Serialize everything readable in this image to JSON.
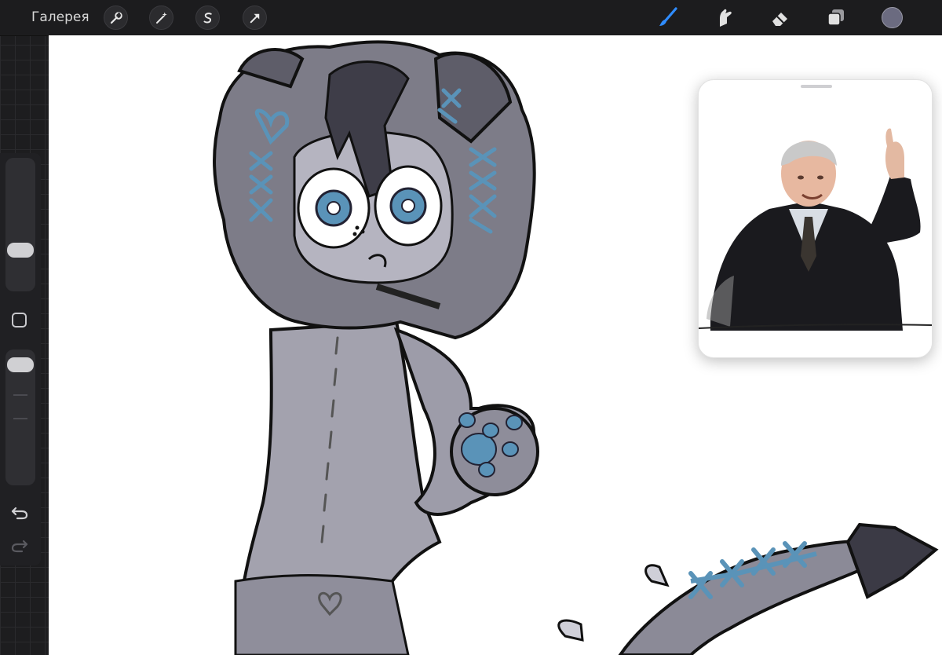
{
  "topbar": {
    "gallery_label": "Галерея",
    "left_tools": [
      {
        "icon": "wrench-icon",
        "name": "actions"
      },
      {
        "icon": "magic-wand-icon",
        "name": "adjustments"
      },
      {
        "icon": "selection-s-icon",
        "name": "selection"
      },
      {
        "icon": "arrow-cursor-icon",
        "name": "transform"
      }
    ],
    "right_tools": [
      {
        "icon": "brush-icon",
        "name": "brush",
        "active": true
      },
      {
        "icon": "smudge-icon",
        "name": "smudge"
      },
      {
        "icon": "eraser-icon",
        "name": "eraser"
      },
      {
        "icon": "layers-icon",
        "name": "layers"
      }
    ],
    "active_tool_color": "#2f8cff",
    "current_color": "#6b6b80"
  },
  "sidebar": {
    "brush_size_level": 0.72,
    "opacity_level": 0.05
  },
  "colors": {
    "canvas_background": "#ffffff",
    "ui_background": "#1c1c1e",
    "character_fill": "#9a99a6",
    "character_dark": "#4a4955",
    "accent_blue": "#5a93b8"
  },
  "reference_window": {
    "visible": true
  }
}
